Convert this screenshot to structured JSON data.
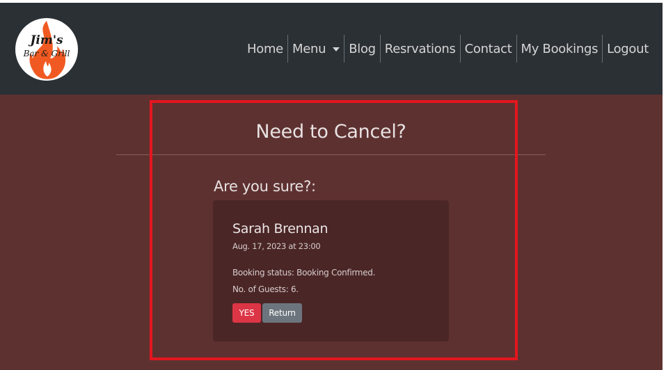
{
  "brand": {
    "line1": "Jim's",
    "line2": "Bar & Grill",
    "icon": "flame-logo"
  },
  "nav": {
    "home": "Home",
    "menu": "Menu",
    "blog": "Blog",
    "reservations": "Resrvations",
    "contact": "Contact",
    "my_bookings": "My Bookings",
    "logout": "Logout"
  },
  "page": {
    "title": "Need to Cancel?",
    "subheading": "Are you sure?:"
  },
  "booking": {
    "name": "Sarah Brennan",
    "datetime": "Aug. 17, 2023 at 23:00",
    "status": "Booking status: Booking Confirmed.",
    "guests": "No. of Guests: 6."
  },
  "actions": {
    "yes_label": "YES",
    "return_label": "Return"
  },
  "colors": {
    "navbar": "#2b3035",
    "page_bg": "#5e3131",
    "card_bg": "#4b2626",
    "highlight": "#e3161e",
    "danger": "#dc3545",
    "secondary": "#6c757d"
  }
}
